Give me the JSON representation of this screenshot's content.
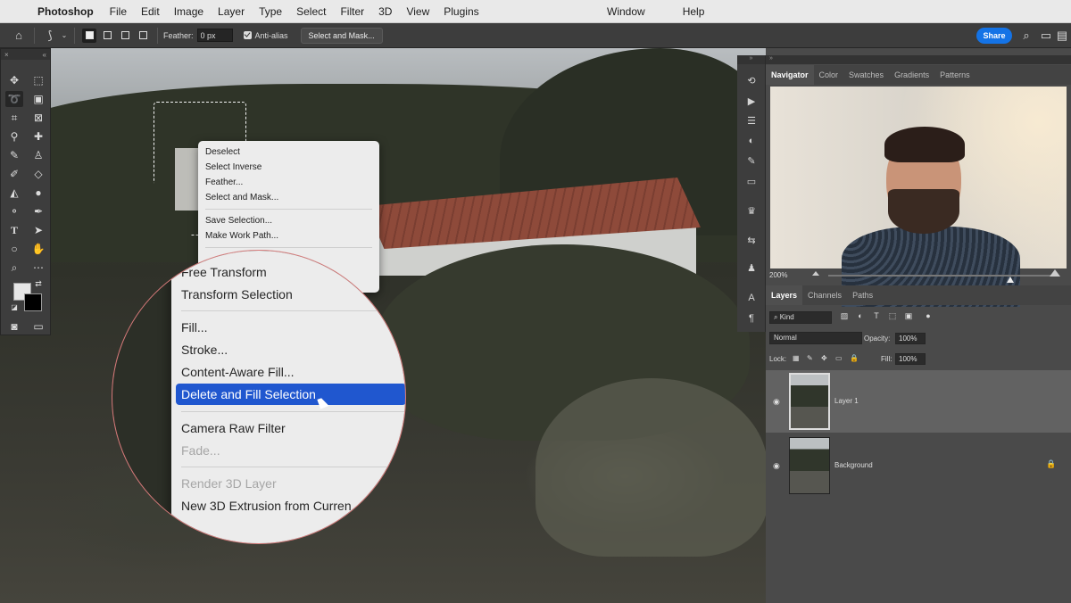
{
  "menubar": {
    "app_name": "Photoshop",
    "items": [
      "File",
      "Edit",
      "Image",
      "Layer",
      "Type",
      "Select",
      "Filter",
      "3D",
      "View",
      "Plugins"
    ],
    "right_items": [
      "Window",
      "Help"
    ]
  },
  "options_bar": {
    "feather_label": "Feather:",
    "feather_value": "0 px",
    "antialias_label": "Anti-alias",
    "antialias_checked": true,
    "select_mask_label": "Select and Mask...",
    "share_label": "Share"
  },
  "context_menu": {
    "items": [
      "Deselect",
      "Select Inverse",
      "Feather...",
      "Select and Mask...",
      "Save Selection...",
      "Make Work Path..."
    ]
  },
  "magnified_menu": {
    "items": [
      {
        "label": "Free Transform",
        "disabled": false
      },
      {
        "label": "Transform Selection",
        "disabled": false
      },
      {
        "label": "Fill...",
        "disabled": false
      },
      {
        "label": "Stroke...",
        "disabled": false
      },
      {
        "label": "Content-Aware Fill...",
        "disabled": false
      },
      {
        "label": "Delete and Fill Selection",
        "disabled": false,
        "highlighted": true
      },
      {
        "label": "Camera Raw Filter",
        "disabled": false
      },
      {
        "label": "Fade...",
        "disabled": true
      },
      {
        "label": "Render 3D Layer",
        "disabled": true
      },
      {
        "label": "New 3D Extrusion from Curren",
        "disabled": false
      }
    ],
    "highlight_color": "#2057cf"
  },
  "navigator": {
    "tabs": [
      "Navigator",
      "Color",
      "Swatches",
      "Gradients",
      "Patterns"
    ],
    "active_tab": "Navigator",
    "zoom": "200%"
  },
  "layers_panel": {
    "tabs": [
      "Layers",
      "Channels",
      "Paths"
    ],
    "active_tab": "Layers",
    "kind_label": "Kind",
    "blend_mode": "Normal",
    "opacity_label": "Opacity:",
    "opacity_value": "100%",
    "lock_label": "Lock:",
    "fill_label": "Fill:",
    "fill_value": "100%",
    "layers": [
      {
        "name": "Layer 1",
        "selected": true,
        "locked": false
      },
      {
        "name": "Background",
        "selected": false,
        "locked": true
      }
    ]
  },
  "colors": {
    "accent": "#1473e6",
    "panel_bg": "#4a4a4a"
  }
}
